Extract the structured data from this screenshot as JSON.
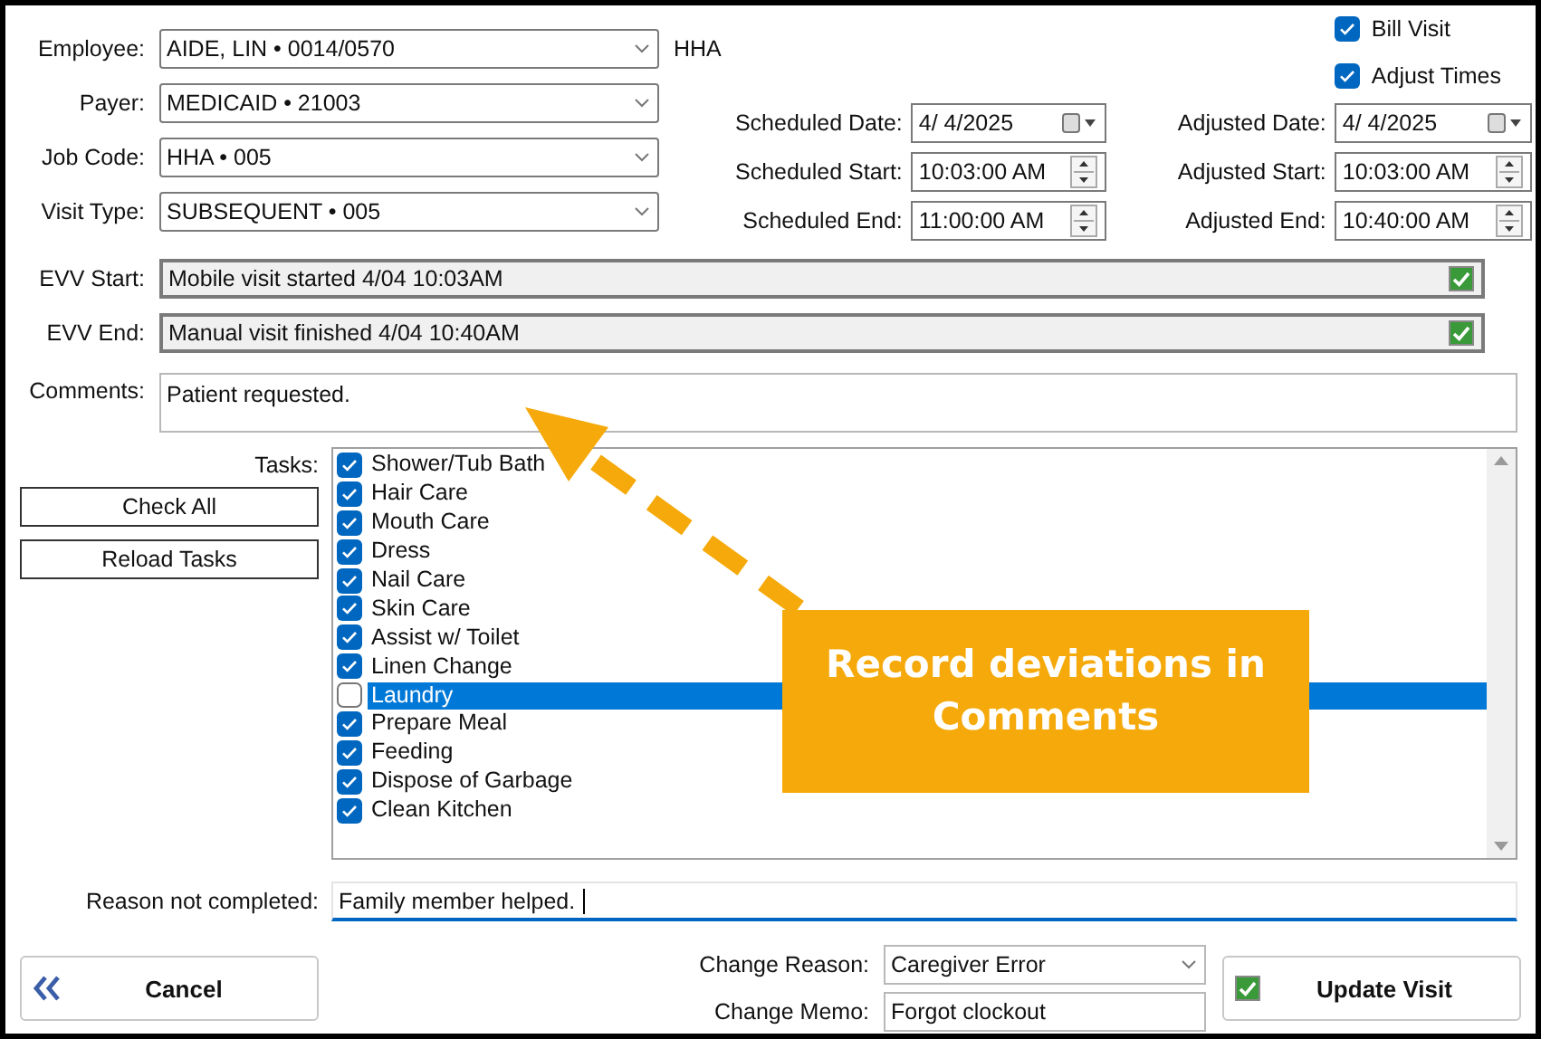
{
  "selects": [
    {
      "label": "Employee:",
      "value": "AIDE, LIN • 0014/0570"
    },
    {
      "label": "Payer:",
      "value": "MEDICAID • 21003"
    },
    {
      "label": "Job Code:",
      "value": "HHA • 005"
    },
    {
      "label": "Visit Type:",
      "value": "SUBSEQUENT • 005"
    }
  ],
  "discipline": "HHA",
  "options": [
    {
      "label": "Bill Visit",
      "checked": true
    },
    {
      "label": "Adjust Times",
      "checked": true
    }
  ],
  "schedule": [
    {
      "kind": "date",
      "label": "Scheduled Date:",
      "value": "4/  4/2025",
      "adjusted_label": "Adjusted Date:",
      "adjusted_value": "4/  4/2025"
    },
    {
      "kind": "time",
      "label": "Scheduled Start:",
      "value": "10:03:00 AM",
      "adjusted_label": "Adjusted Start:",
      "adjusted_value": "10:03:00 AM"
    },
    {
      "kind": "time",
      "label": "Scheduled End:",
      "value": "11:00:00 AM",
      "adjusted_label": "Adjusted End:",
      "adjusted_value": "10:40:00 AM"
    }
  ],
  "evv": [
    {
      "label": "EVV Start:",
      "value": "Mobile visit started 4/04 10:03AM",
      "checked": true
    },
    {
      "label": "EVV End:",
      "value": "Manual visit finished 4/04 10:40AM",
      "checked": true
    }
  ],
  "comments": {
    "label": "Comments:",
    "value": "Patient requested."
  },
  "tasks": {
    "label": "Tasks:",
    "buttons": [
      "Check All",
      "Reload Tasks"
    ],
    "items": [
      {
        "label": "Shower/Tub Bath",
        "checked": true,
        "selected": false
      },
      {
        "label": "Hair Care",
        "checked": true,
        "selected": false
      },
      {
        "label": "Mouth Care",
        "checked": true,
        "selected": false
      },
      {
        "label": "Dress",
        "checked": true,
        "selected": false
      },
      {
        "label": "Nail Care",
        "checked": true,
        "selected": false
      },
      {
        "label": "Skin Care",
        "checked": true,
        "selected": false
      },
      {
        "label": "Assist w/ Toilet",
        "checked": true,
        "selected": false
      },
      {
        "label": "Linen Change",
        "checked": true,
        "selected": false
      },
      {
        "label": "Laundry",
        "checked": false,
        "selected": true
      },
      {
        "label": "Prepare Meal",
        "checked": true,
        "selected": false
      },
      {
        "label": "Feeding",
        "checked": true,
        "selected": false
      },
      {
        "label": "Dispose of Garbage",
        "checked": true,
        "selected": false
      },
      {
        "label": "Clean Kitchen",
        "checked": true,
        "selected": false
      }
    ]
  },
  "reason": {
    "label": "Reason not completed:",
    "value": "Family member helped. "
  },
  "change_reason": {
    "label": "Change Reason:",
    "value": "Caregiver Error"
  },
  "change_memo": {
    "label": "Change Memo:",
    "value": "Forgot clockout"
  },
  "cancel_button": "Cancel",
  "update_button": "Update Visit",
  "callout": "Record deviations in Comments"
}
